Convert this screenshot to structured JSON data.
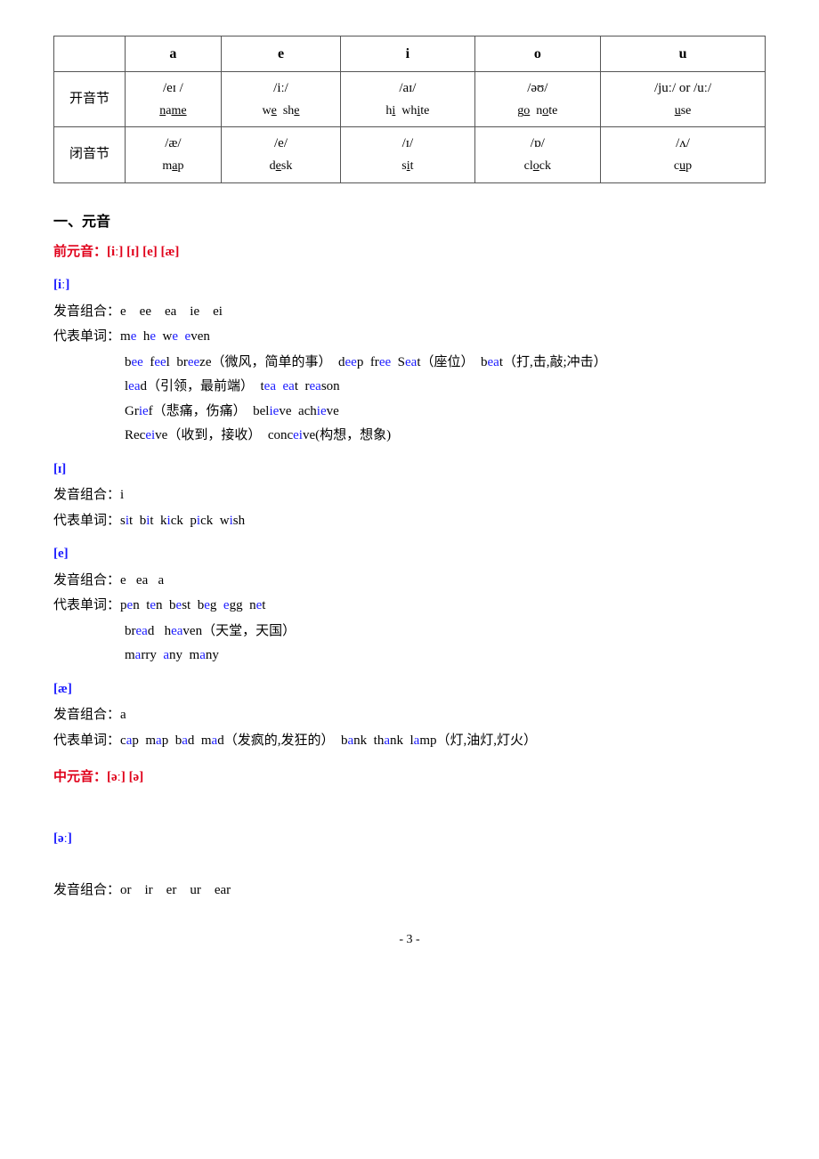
{
  "table": {
    "headers": [
      "",
      "a",
      "e",
      "i",
      "o",
      "u"
    ],
    "rows": [
      {
        "header": "开音节",
        "cells": [
          {
            "phoneme": "/eɪ /",
            "example": "name"
          },
          {
            "phoneme": "/iː/",
            "example": "we  she"
          },
          {
            "phoneme": "/aɪ/",
            "example": "hɪ  white"
          },
          {
            "phoneme": "/əʊ/",
            "example": "go  note"
          },
          {
            "phoneme": "/juː/ or /uː/",
            "example": "use"
          }
        ]
      },
      {
        "header": "闭音节",
        "cells": [
          {
            "phoneme": "/æ/",
            "example": "map"
          },
          {
            "phoneme": "/e/",
            "example": "desk"
          },
          {
            "phoneme": "/ɪ/",
            "example": "sit"
          },
          {
            "phoneme": "/ɒ/",
            "example": "clock"
          },
          {
            "phoneme": "/ʌ/",
            "example": "cup"
          }
        ]
      }
    ]
  },
  "section1": {
    "title": "一、元音",
    "front_vowel_title": "前元音：[iː]  [ɪ]  [e]  [æ]",
    "phonemes": [
      {
        "symbol": "[iː]",
        "sound_combo_label": "发音组合：",
        "sound_combo": "e    ee    ea    ie    ei",
        "rep_word_label": "代表单词：",
        "rep_word": "me  he  we  even",
        "examples": [
          "bee  feel  breeze（微风，简单的事）  deep  free  Seat（座位）  beat（打,击,敲;冲击）",
          "lead（引领，最前端）  tea  eat  reason",
          "Grief（悲痛，伤痛）  believe  achieve",
          "Receive（收到，接收）  conceive(构想，想象)"
        ]
      },
      {
        "symbol": "[ɪ]",
        "sound_combo_label": "发音组合：",
        "sound_combo": "i",
        "rep_word_label": "代表单词：",
        "rep_word": "sit  bit  kick  pick  wish",
        "examples": []
      },
      {
        "symbol": "[e]",
        "sound_combo_label": "发音组合：",
        "sound_combo": "e    ea    a",
        "rep_word_label": "代表单词：",
        "rep_word": "pen  ten  best  beg  egg  net",
        "examples": [
          "bread   heaven（天堂，天国）",
          "marry  any  many"
        ]
      },
      {
        "symbol": "[æ]",
        "sound_combo_label": "发音组合：",
        "sound_combo": "a",
        "rep_word_label": "代表单词：",
        "rep_word": "cap  map  bad  mad（发疯的,发狂的）  bank  thank  lamp（灯,油灯,灯火）",
        "examples": []
      }
    ]
  },
  "section2": {
    "mid_vowel_title": "中元音：[əː]  [ə]",
    "phonemes": [
      {
        "symbol": "[əː]",
        "sound_combo_label": "发音组合：",
        "sound_combo": "or    ir    er    ur    ear",
        "rep_word_label": "",
        "rep_word": "",
        "examples": []
      }
    ]
  },
  "page_number": "- 3 -"
}
